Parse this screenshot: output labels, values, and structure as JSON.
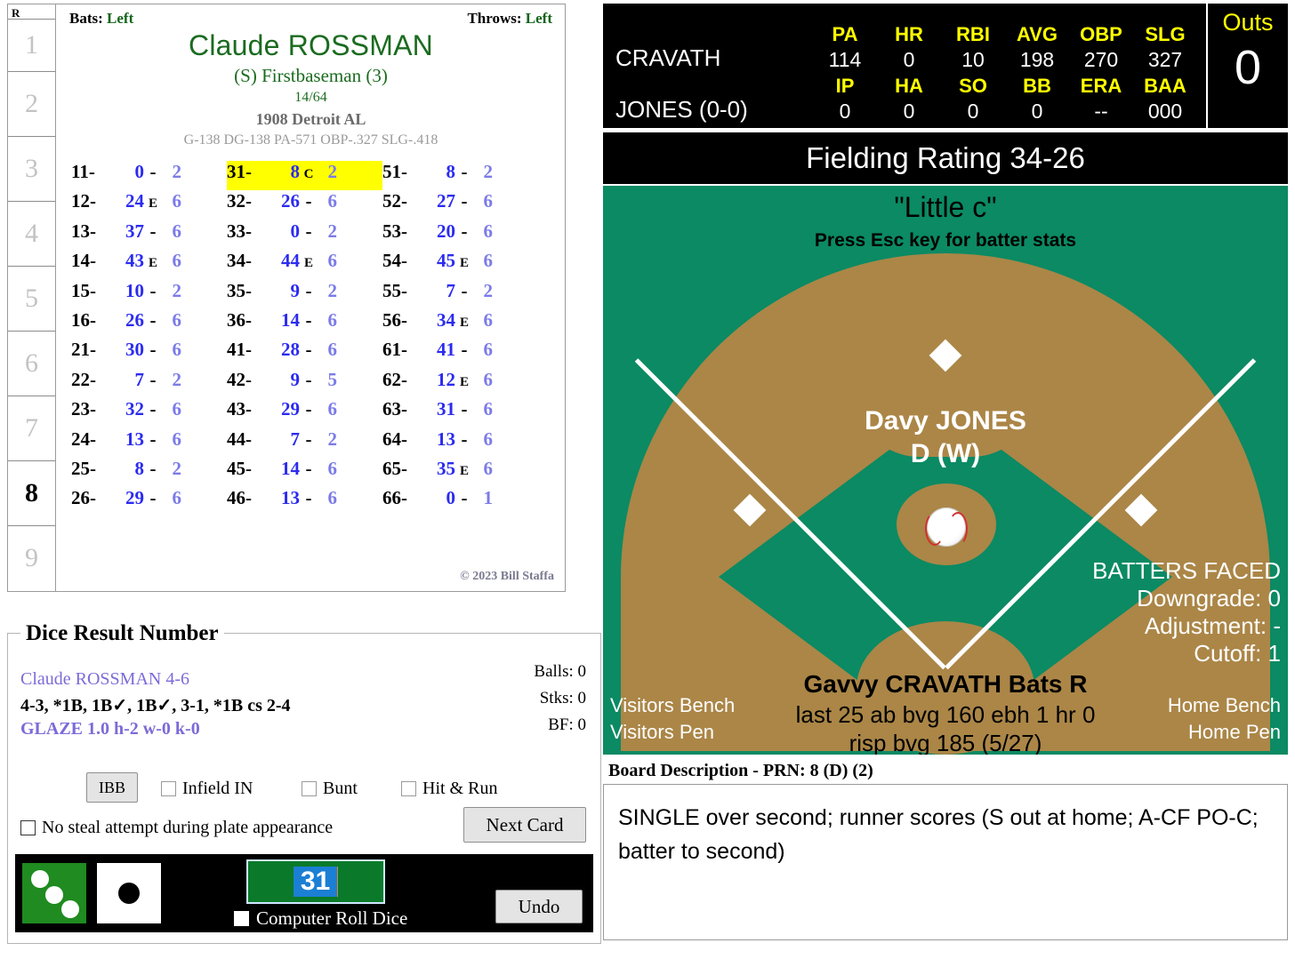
{
  "player_card": {
    "innings_header": "R",
    "innings": [
      {
        "n": "1",
        "current": false
      },
      {
        "n": "2",
        "current": false
      },
      {
        "n": "3",
        "current": false
      },
      {
        "n": "4",
        "current": false
      },
      {
        "n": "5",
        "current": false
      },
      {
        "n": "6",
        "current": false
      },
      {
        "n": "7",
        "current": false
      },
      {
        "n": "8",
        "current": true
      },
      {
        "n": "9",
        "current": false
      }
    ],
    "bats_label": "Bats:",
    "bats_value": "Left",
    "throws_label": "Throws:",
    "throws_value": "Left",
    "name": "Claude ROSSMAN",
    "position": "(S) Firstbaseman (3)",
    "fraction": "14/64",
    "team": "1908 Detroit AL",
    "stat_line": "G-138 DG-138 PA-571 OBP-.327 SLG-.418",
    "copyright": "© 2023 Bill Staffa",
    "dice_columns": [
      [
        {
          "key": "11-",
          "val": "0",
          "mid": "-",
          "last": "2",
          "hl": false
        },
        {
          "key": "12-",
          "val": "24",
          "mid": "E",
          "last": "6",
          "hl": false
        },
        {
          "key": "13-",
          "val": "37",
          "mid": "-",
          "last": "6",
          "hl": false
        },
        {
          "key": "14-",
          "val": "43",
          "mid": "E",
          "last": "6",
          "hl": false
        },
        {
          "key": "15-",
          "val": "10",
          "mid": "-",
          "last": "2",
          "hl": false
        },
        {
          "key": "16-",
          "val": "26",
          "mid": "-",
          "last": "6",
          "hl": false
        },
        {
          "key": "21-",
          "val": "30",
          "mid": "-",
          "last": "6",
          "hl": false
        },
        {
          "key": "22-",
          "val": "7",
          "mid": "-",
          "last": "2",
          "hl": false
        },
        {
          "key": "23-",
          "val": "32",
          "mid": "-",
          "last": "6",
          "hl": false
        },
        {
          "key": "24-",
          "val": "13",
          "mid": "-",
          "last": "6",
          "hl": false
        },
        {
          "key": "25-",
          "val": "8",
          "mid": "-",
          "last": "2",
          "hl": false
        },
        {
          "key": "26-",
          "val": "29",
          "mid": "-",
          "last": "6",
          "hl": false
        }
      ],
      [
        {
          "key": "31-",
          "val": "8",
          "mid": "C",
          "last": "2",
          "hl": true
        },
        {
          "key": "32-",
          "val": "26",
          "mid": "-",
          "last": "6",
          "hl": false
        },
        {
          "key": "33-",
          "val": "0",
          "mid": "-",
          "last": "2",
          "hl": false
        },
        {
          "key": "34-",
          "val": "44",
          "mid": "E",
          "last": "6",
          "hl": false
        },
        {
          "key": "35-",
          "val": "9",
          "mid": "-",
          "last": "2",
          "hl": false
        },
        {
          "key": "36-",
          "val": "14",
          "mid": "-",
          "last": "6",
          "hl": false
        },
        {
          "key": "41-",
          "val": "28",
          "mid": "-",
          "last": "6",
          "hl": false
        },
        {
          "key": "42-",
          "val": "9",
          "mid": "-",
          "last": "5",
          "hl": false
        },
        {
          "key": "43-",
          "val": "29",
          "mid": "-",
          "last": "6",
          "hl": false
        },
        {
          "key": "44-",
          "val": "7",
          "mid": "-",
          "last": "2",
          "hl": false
        },
        {
          "key": "45-",
          "val": "14",
          "mid": "-",
          "last": "6",
          "hl": false
        },
        {
          "key": "46-",
          "val": "13",
          "mid": "-",
          "last": "6",
          "hl": false
        }
      ],
      [
        {
          "key": "51-",
          "val": "8",
          "mid": "-",
          "last": "2",
          "hl": false
        },
        {
          "key": "52-",
          "val": "27",
          "mid": "-",
          "last": "6",
          "hl": false
        },
        {
          "key": "53-",
          "val": "20",
          "mid": "-",
          "last": "6",
          "hl": false
        },
        {
          "key": "54-",
          "val": "45",
          "mid": "E",
          "last": "6",
          "hl": false
        },
        {
          "key": "55-",
          "val": "7",
          "mid": "-",
          "last": "2",
          "hl": false
        },
        {
          "key": "56-",
          "val": "34",
          "mid": "E",
          "last": "6",
          "hl": false
        },
        {
          "key": "61-",
          "val": "41",
          "mid": "-",
          "last": "6",
          "hl": false
        },
        {
          "key": "62-",
          "val": "12",
          "mid": "E",
          "last": "6",
          "hl": false
        },
        {
          "key": "63-",
          "val": "31",
          "mid": "-",
          "last": "6",
          "hl": false
        },
        {
          "key": "64-",
          "val": "13",
          "mid": "-",
          "last": "6",
          "hl": false
        },
        {
          "key": "65-",
          "val": "35",
          "mid": "E",
          "last": "6",
          "hl": false
        },
        {
          "key": "66-",
          "val": "0",
          "mid": "-",
          "last": "1",
          "hl": false
        }
      ]
    ]
  },
  "dice_panel": {
    "legend": "Dice Result Number",
    "batter_line": "Claude ROSSMAN  4-6",
    "result_line": "4-3, *1B, 1B✓, 1B✓, 3-1, *1B cs 2-4",
    "pitcher_line": "GLAZE  1.0  h-2  w-0  k-0",
    "counts": {
      "balls": "Balls: 0",
      "strikes": "Stks: 0",
      "bf": "BF: 0"
    },
    "ibb_label": "IBB",
    "infield_in_label": "Infield IN",
    "bunt_label": "Bunt",
    "hit_run_label": "Hit & Run",
    "no_steal_label": "No steal attempt during plate appearance",
    "next_card_label": "Next Card",
    "roll_value": "31",
    "computer_roll_label": "Computer Roll Dice",
    "undo_label": "Undo",
    "die_green_pips": 3,
    "die_white_pips": 1
  },
  "scoreboard": {
    "batter_name": "CRAVATH",
    "pitcher_name": "JONES (0-0)",
    "batting_headers": [
      "PA",
      "HR",
      "RBI",
      "AVG",
      "OBP",
      "SLG"
    ],
    "batting_values": [
      "114",
      "0",
      "10",
      "198",
      "270",
      "327"
    ],
    "pitching_headers": [
      "IP",
      "HA",
      "SO",
      "BB",
      "ERA",
      "BAA"
    ],
    "pitching_values": [
      "0",
      "0",
      "0",
      "0",
      "--",
      "000"
    ],
    "outs_label": "Outs",
    "outs_value": "0",
    "colors": {
      "header_yellow": "#ffff00",
      "value_white": "#ffffff",
      "background": "#000000"
    }
  },
  "fielding_rating": "Fielding Rating 34-26",
  "field": {
    "nickname": "\"Little c\"",
    "esc_hint": "Press Esc key for batter stats",
    "pitcher_name": "Davy JONES",
    "pitcher_hand": "D (W)",
    "batters_faced": {
      "title": "BATTERS FACED",
      "downgrade": "Downgrade: 0",
      "adjustment": "Adjustment: -",
      "cutoff": "Cutoff: 1"
    },
    "visitors_bench": "Visitors Bench",
    "visitors_pen": "Visitors Pen",
    "home_bench": "Home Bench",
    "home_pen": "Home Pen",
    "batter_name": "Gavvy CRAVATH Bats R",
    "batter_line1": "last 25 ab bvg 160 ebh 1 hr 0",
    "batter_line2": "risp bvg 185 (5/27)",
    "colors": {
      "grass": "#0b8a63",
      "dirt": "#ab8647",
      "lines": "#ffffff"
    }
  },
  "board": {
    "title": "Board Description - PRN: 8 (D) (2)",
    "description": "SINGLE over second; runner scores (S out at home; A-CF PO-C; batter to second)"
  }
}
